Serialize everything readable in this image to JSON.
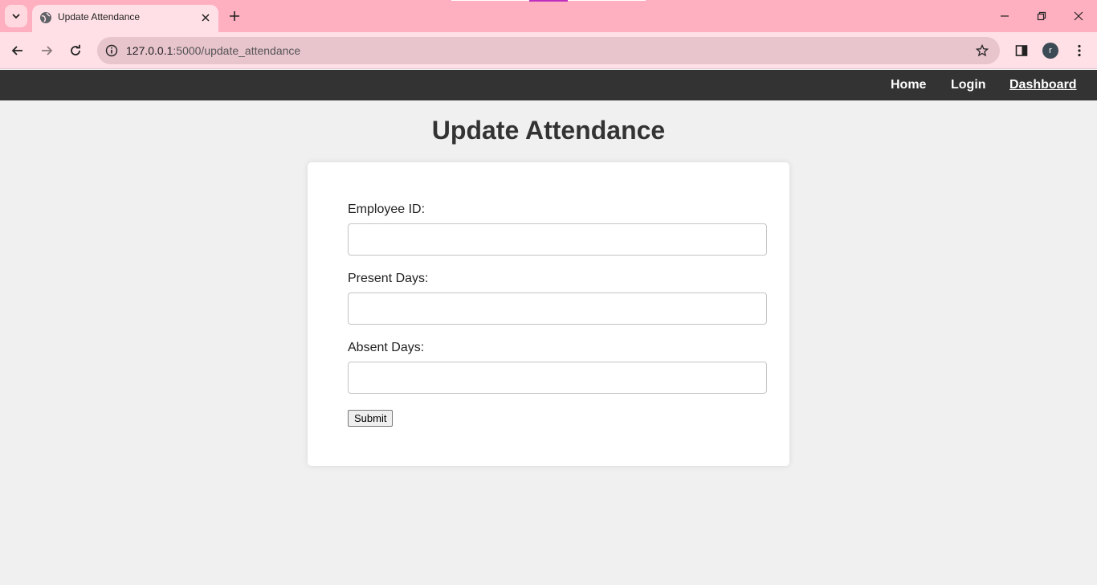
{
  "browser": {
    "tab_title": "Update Attendance",
    "url_host": "127.0.0.1",
    "url_rest": ":5000/update_attendance"
  },
  "nav": {
    "home": "Home",
    "login": "Login",
    "dashboard": "Dashboard"
  },
  "page": {
    "title": "Update Attendance"
  },
  "form": {
    "employee_id_label": "Employee ID:",
    "employee_id_value": "",
    "present_days_label": "Present Days:",
    "present_days_value": "",
    "absent_days_label": "Absent Days:",
    "absent_days_value": "",
    "submit_label": "Submit"
  },
  "colors": {
    "tabstrip": "#ffb0c0",
    "navbar": "#333333",
    "page_bg": "#f0f0f0"
  }
}
